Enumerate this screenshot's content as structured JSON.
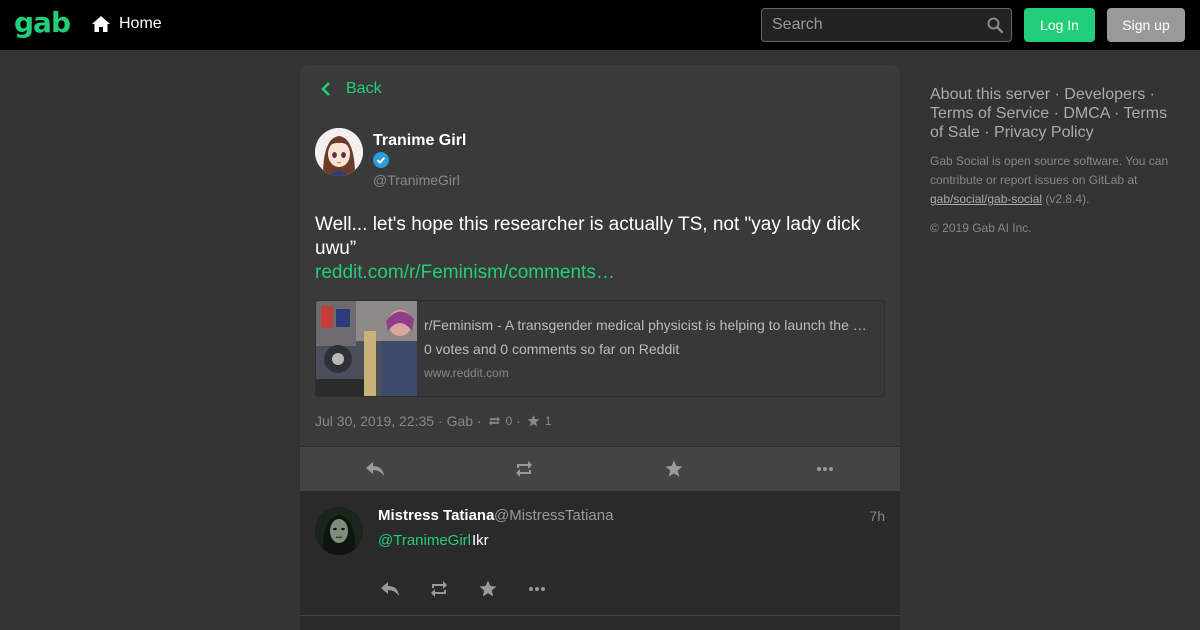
{
  "header": {
    "logo": "gab",
    "home_label": "Home",
    "search_placeholder": "Search",
    "login_label": "Log In",
    "signup_label": "Sign up"
  },
  "status": {
    "back_label": "Back",
    "author": {
      "display_name": "Tranime Girl",
      "handle": "@TranimeGirl",
      "verified": true
    },
    "text": "Well... let's hope this researcher is actually TS, not \"yay lady dick uwu”",
    "link": "reddit.com/r/Feminism/comments…",
    "card": {
      "title": "r/Feminism - A transgender medical physicist is helping to launch the 1…",
      "description": "0 votes and 0 comments so far on Reddit",
      "domain": "www.reddit.com"
    },
    "meta": {
      "timestamp": "Jul 30, 2019, 22:35",
      "source": "Gab",
      "reposts": "0",
      "favorites": "1"
    }
  },
  "reply": {
    "display_name": "Mistress Tatiana",
    "handle": "@MistressTatiana",
    "time": "7h",
    "mention": "@TranimeGirl",
    "text": "Ikr"
  },
  "sidebar": {
    "links": [
      "About this server",
      "Developers",
      "Terms of Service",
      "DMCA",
      "Terms of Sale",
      "Privacy Policy"
    ],
    "note_prefix": "Gab Social is open source software. You can contribute or report issues on GitLab at",
    "repo": "gab/social/gab-social",
    "version": "(v2.8.4).",
    "copyright": "© 2019 Gab AI Inc."
  },
  "colors": {
    "accent": "#21cf7a",
    "background": "#333333",
    "topbar": "#000000"
  }
}
